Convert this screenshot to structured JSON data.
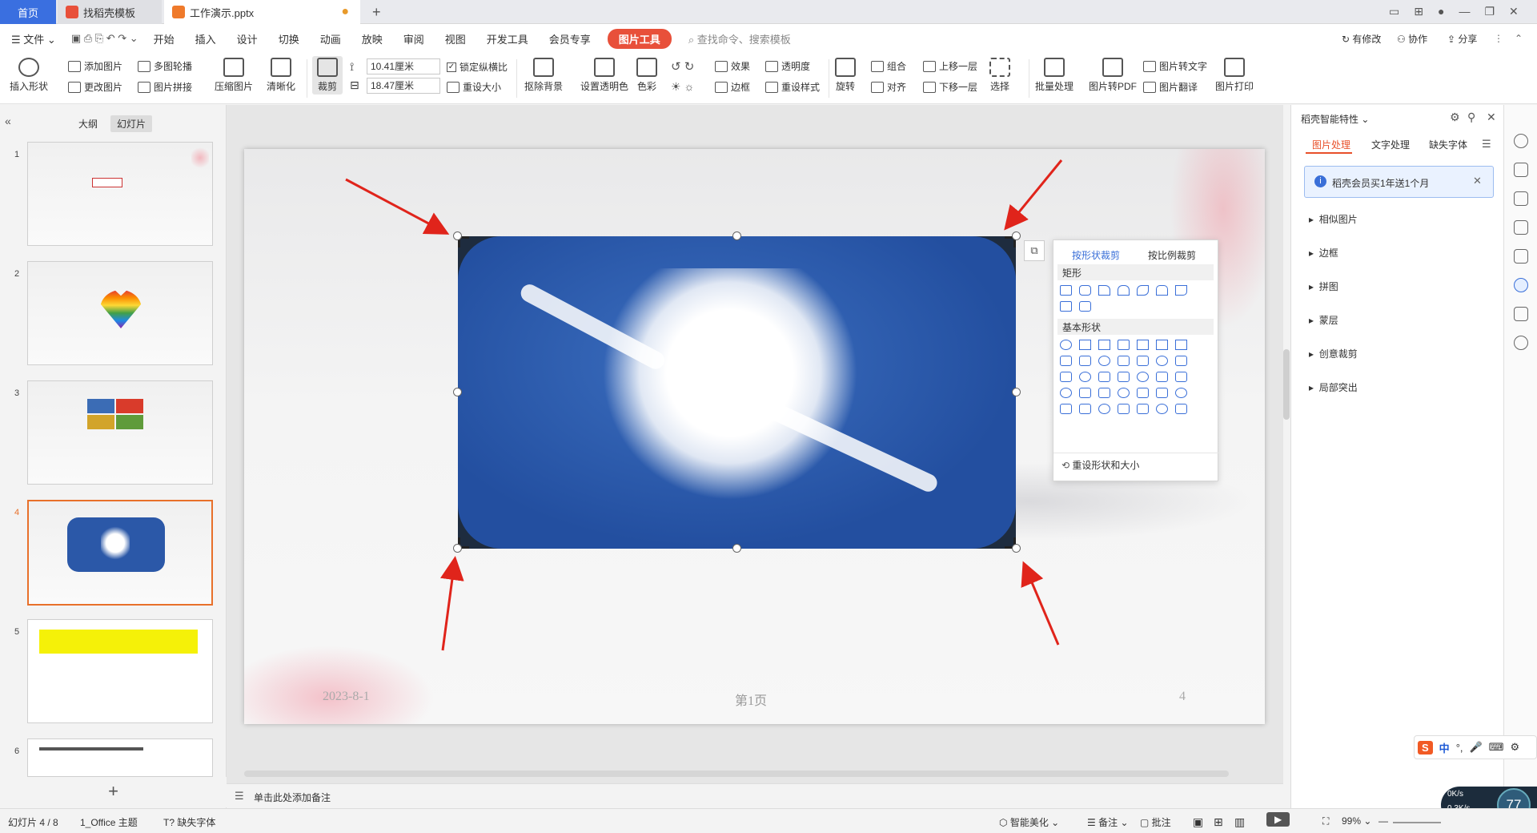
{
  "titlebar": {
    "tabs": [
      {
        "label": "首页"
      },
      {
        "label": "找稻壳模板"
      },
      {
        "label": "工作演示.pptx"
      }
    ],
    "new_tab": "+"
  },
  "menu": {
    "file": "文件",
    "items": [
      "开始",
      "插入",
      "设计",
      "切换",
      "动画",
      "放映",
      "审阅",
      "视图",
      "开发工具",
      "会员专享"
    ],
    "active": "图片工具",
    "search_placeholder": "查找命令、搜索模板",
    "right": [
      "有修改",
      "协作",
      "分享"
    ]
  },
  "ribbon": {
    "insert_shape": "插入形状",
    "add_image": "添加图片",
    "change_image": "更改图片",
    "multi_outline": "多图轮播",
    "image_collage": "图片拼接",
    "compress": "压缩图片",
    "sharpen": "清晰化",
    "crop": "裁剪",
    "width": "10.41厘米",
    "height": "18.47厘米",
    "lock_ratio": "锁定纵横比",
    "reset_size": "重设大小",
    "remove_bg": "抠除背景",
    "set_transparent": "设置透明色",
    "color": "色彩",
    "effect": "效果",
    "transparency": "透明度",
    "border": "边框",
    "reset_style": "重设样式",
    "rotate": "旋转",
    "group": "组合",
    "align": "对齐",
    "bring_forward": "上移一层",
    "send_backward": "下移一层",
    "select": "选择",
    "batch": "批量处理",
    "to_pdf": "图片转PDF",
    "to_text": "图片转文字",
    "translate": "图片翻译",
    "print": "图片打印"
  },
  "leftpanel": {
    "tabs": [
      "大纲",
      "幻灯片"
    ],
    "slides": [
      "1",
      "2",
      "3",
      "4",
      "5",
      "6"
    ],
    "add": "+"
  },
  "slide": {
    "date": "2023-8-1",
    "page": "第1页",
    "number": "4"
  },
  "croppop": {
    "tabs": [
      "按形状裁剪",
      "按比例裁剪"
    ],
    "section1": "矩形",
    "section2": "基本形状",
    "reset": "重设形状和大小"
  },
  "notes": {
    "placeholder": "单击此处添加备注"
  },
  "rightpanel": {
    "title": "稻壳智能特性",
    "tabs": [
      "图片处理",
      "文字处理",
      "缺失字体"
    ],
    "banner": "稻壳会员买1年送1个月",
    "items": [
      "相似图片",
      "边框",
      "拼图",
      "蒙层",
      "创意裁剪",
      "局部突出"
    ]
  },
  "status": {
    "slide": "幻灯片 4 / 8",
    "theme": "1_Office 主题",
    "missing_font": "缺失字体",
    "beautify": "智能美化",
    "notes": "备注",
    "comment": "批注",
    "zoom": "99%"
  },
  "overlay": {
    "ime": "中",
    "speed_up": "0K/s",
    "speed_down": "0.3K/s",
    "cpu": "77"
  }
}
